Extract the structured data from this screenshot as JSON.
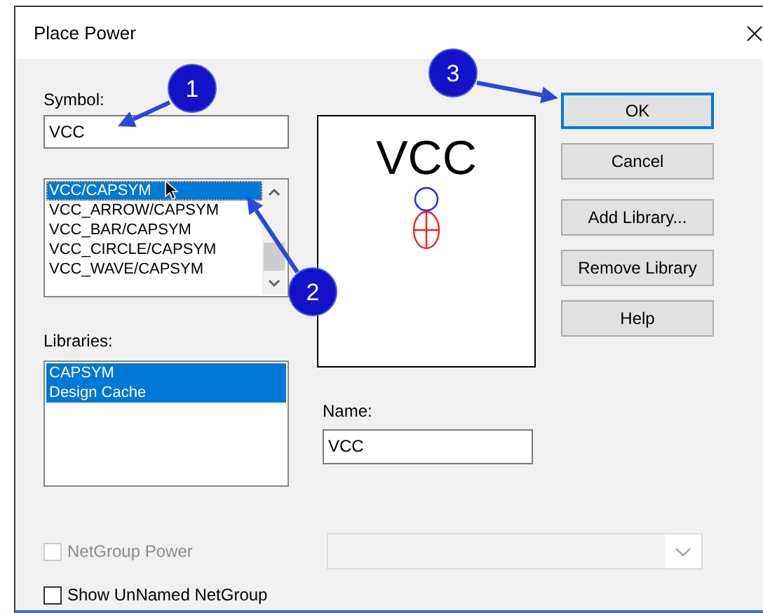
{
  "window": {
    "title": "Place Power"
  },
  "symbol": {
    "label": "Symbol:",
    "value": "VCC"
  },
  "symbol_list": {
    "items": [
      {
        "label": "VCC/CAPSYM",
        "selected": true
      },
      {
        "label": "VCC_ARROW/CAPSYM",
        "selected": false
      },
      {
        "label": "VCC_BAR/CAPSYM",
        "selected": false
      },
      {
        "label": "VCC_CIRCLE/CAPSYM",
        "selected": false
      },
      {
        "label": "VCC_WAVE/CAPSYM",
        "selected": false
      }
    ]
  },
  "libraries": {
    "label": "Libraries:",
    "items": [
      {
        "label": "CAPSYM",
        "selected": true
      },
      {
        "label": "Design Cache",
        "selected": true
      }
    ]
  },
  "preview": {
    "symbol_text": "VCC"
  },
  "name": {
    "label": "Name:",
    "value": "VCC"
  },
  "buttons": [
    {
      "label": "OK",
      "default": true
    },
    {
      "label": "Cancel",
      "default": false
    },
    {
      "label": "Add Library...",
      "default": false
    },
    {
      "label": "Remove Library",
      "default": false
    },
    {
      "label": "Help",
      "default": false
    }
  ],
  "checkboxes": [
    {
      "label": "NetGroup Power",
      "checked": false,
      "disabled": true
    },
    {
      "label": "Show UnNamed NetGroup",
      "checked": false,
      "disabled": false
    }
  ],
  "netgroup_dropdown": {
    "disabled": true
  },
  "callouts": [
    {
      "label": "1"
    },
    {
      "label": "2"
    },
    {
      "label": "3"
    }
  ]
}
